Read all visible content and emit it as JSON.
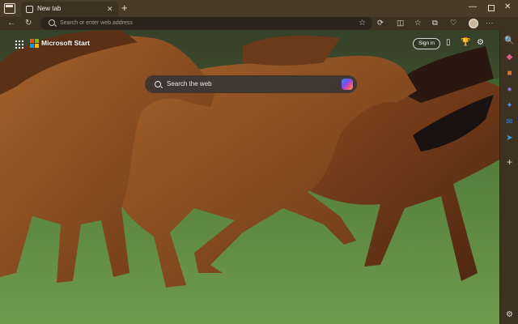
{
  "tab": {
    "title": "New tab",
    "close_glyph": "✕"
  },
  "new_tab_glyph": "+",
  "window_controls": {
    "minimize": "—",
    "close": "✕"
  },
  "nav": {
    "back": "←",
    "refresh": "↻"
  },
  "address": {
    "placeholder": "Search or enter web address",
    "favorite_glyph": "☆"
  },
  "toolbar": {
    "icons": [
      {
        "name": "refresh-page-icon",
        "glyph": "⟳"
      },
      {
        "name": "split-screen-icon",
        "glyph": "◫"
      },
      {
        "name": "favorites-icon",
        "glyph": "☆"
      },
      {
        "name": "collections-icon",
        "glyph": "⧉"
      },
      {
        "name": "browser-essentials-icon",
        "glyph": "♡"
      },
      {
        "name": "more-options-icon",
        "glyph": "···"
      }
    ]
  },
  "header": {
    "brand": "Microsoft Start",
    "signin": "Sign in",
    "icons": [
      {
        "name": "mobile-icon",
        "glyph": "▯"
      },
      {
        "name": "rewards-icon",
        "glyph": "🏆"
      },
      {
        "name": "settings-icon",
        "glyph": "⚙"
      }
    ]
  },
  "search": {
    "placeholder": "Search the web"
  },
  "sidebar": {
    "items": [
      {
        "name": "sidebar-search-icon",
        "glyph": "🔍",
        "color": "#e3dace"
      },
      {
        "name": "sidebar-tag-icon",
        "glyph": "◆",
        "color": "#e05a8a"
      },
      {
        "name": "sidebar-briefcase-icon",
        "glyph": "■",
        "color": "#d9752a"
      },
      {
        "name": "sidebar-person-icon",
        "glyph": "●",
        "color": "#8a6fd8"
      },
      {
        "name": "sidebar-copilot-icon",
        "glyph": "✦",
        "color": "#4a8fe0"
      },
      {
        "name": "sidebar-outlook-icon",
        "glyph": "✉",
        "color": "#2f7fe0"
      },
      {
        "name": "sidebar-send-icon",
        "glyph": "➤",
        "color": "#3aa0e8"
      },
      {
        "name": "sidebar-add-icon",
        "glyph": "+",
        "color": "#e3dace"
      },
      {
        "name": "sidebar-settings-icon",
        "glyph": "⚙",
        "color": "#e3dace"
      }
    ]
  },
  "colors": {
    "frame": "#3d3122",
    "tabbar": "#4a3b29",
    "accent_horse": "#8a4e22",
    "grass": "#5f8a3e"
  }
}
